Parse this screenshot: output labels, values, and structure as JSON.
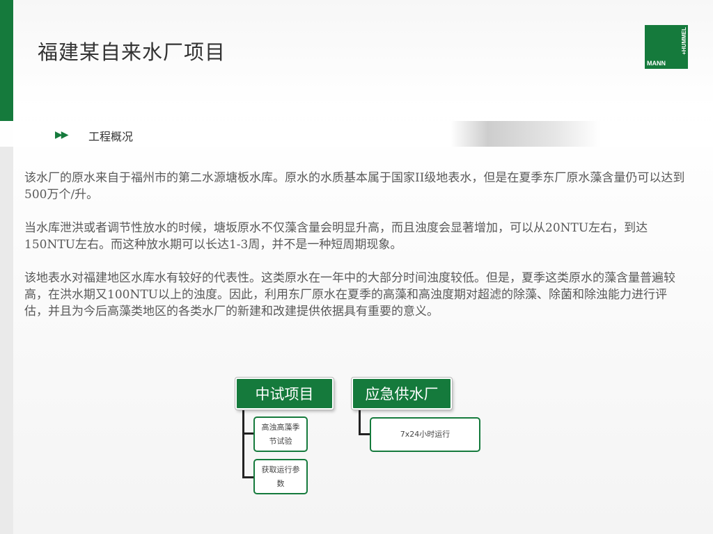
{
  "title": "福建某自来水厂项目",
  "logo": {
    "line1": "MANN",
    "line2": "+HUMMEL"
  },
  "section": {
    "arrows": "▶▶",
    "title": "工程概况"
  },
  "paragraphs": [
    "该水厂的原水来自于福州市的第二水源塘板水库。原水的水质基本属于国家II级地表水，但是在夏季东厂原水藻含量仍可以达到500万个/升。",
    "当水库泄洪或者调节性放水的时候，塘坂原水不仅藻含量会明显升高，而且浊度会显著增加，可以从20NTU左右，到达150NTU左右。而这种放水期可以长达1-3周，并不是一种短周期现象。",
    "该地表水对福建地区水库水有较好的代表性。这类原水在一年中的大部分时间浊度较低。但是，夏季这类原水的藻含量普遍较高，在洪水期又100NTU以上的浊度。因此，利用东厂原水在夏季的高藻和高浊度期对超滤的除藻、除菌和除浊能力进行评估，并且为今后高藻类地区的各类水厂的新建和改建提供依据具有重要的意义。"
  ],
  "diagram": {
    "main1": "中试项目",
    "main2": "应急供水厂",
    "sub1": "高浊高藻季节试验",
    "sub2": "获取运行参数",
    "sub3": "7x24小时运行"
  },
  "colors": {
    "accent": "#157a3c",
    "text": "#595959"
  }
}
